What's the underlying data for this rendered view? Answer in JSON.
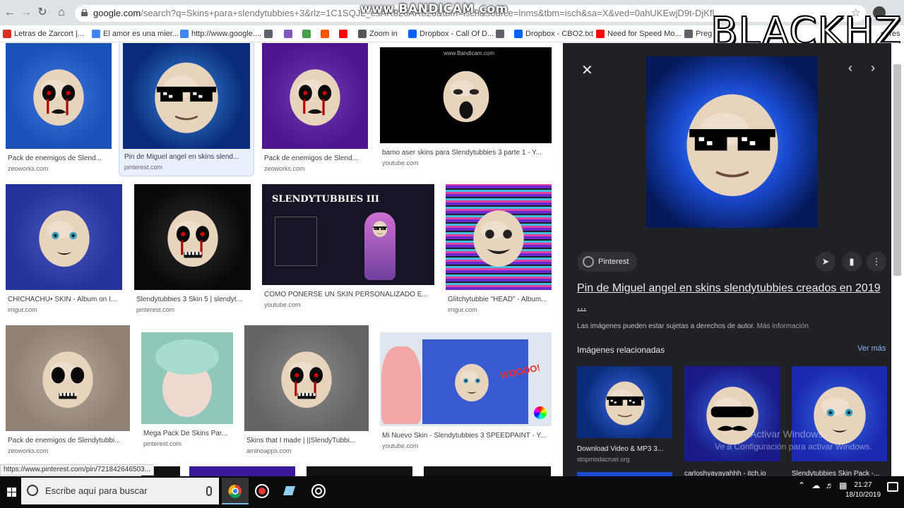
{
  "browser": {
    "url_main": "google.com",
    "url_rest": "/search?q=Skins+para+slendytubbies+3&rlz=1C1SQJL_esAR826AR826&tbm=isch&source=lnms&tbm=isch&sa=X&ved=0ahUKEwjD9t-DjKfl",
    "recorder_watermark": "www.BANDICAM.com"
  },
  "channel_watermark": "BLACKHZ",
  "bookmarks": [
    {
      "label": "Letras de Zarcort |...",
      "icon": "bookmark-zarcort-icon",
      "color": "#d93025"
    },
    {
      "label": "El amor es una mier...",
      "icon": "google-icon",
      "color": "#4285f4"
    },
    {
      "label": "http://www.google....",
      "icon": "google-icon",
      "color": "#4285f4"
    },
    {
      "label": "",
      "icon": "globe-icon",
      "color": "#5f6368"
    },
    {
      "label": "",
      "icon": "tor-icon",
      "color": "#7e57c2"
    },
    {
      "label": "",
      "icon": "gamepad-icon",
      "color": "#43a047"
    },
    {
      "label": "",
      "icon": "soundcloud-icon",
      "color": "#ff5500"
    },
    {
      "label": "",
      "icon": "youtube-icon",
      "color": "#ff0000"
    },
    {
      "label": "Zoom in",
      "icon": "zoom-icon",
      "color": "#555555"
    },
    {
      "label": "Dropbox - Call Of D...",
      "icon": "dropbox-icon",
      "color": "#0061ff"
    },
    {
      "label": "",
      "icon": "globe-icon",
      "color": "#5f6368"
    },
    {
      "label": "Dropbox - CBO2.txt",
      "icon": "dropbox-icon",
      "color": "#0061ff"
    },
    {
      "label": "Need for Speed Mo...",
      "icon": "youtube-icon",
      "color": "#ff0000"
    },
    {
      "label": "Preg",
      "icon": "globe-icon",
      "color": "#5f6368"
    },
    {
      "label": "dores",
      "icon": "",
      "color": "#5f6368"
    }
  ],
  "results": [
    {
      "caption": "Pack de enemigos de Slend...",
      "source": "zeoworks.com",
      "bg": "#1e5fd6"
    },
    {
      "caption": "Pin de Miguel angel en skins slend...",
      "source": "pinterest.com",
      "bg": "#0a2a7a"
    },
    {
      "caption": "Pack de enemigos de Slend...",
      "source": "zeoworks.com",
      "bg": "#5a1aa8"
    },
    {
      "caption": "bamo aser skins para Slendytubbies 3 parte 1 - Y...",
      "source": "youtube.com",
      "bg": "#000000"
    },
    {
      "caption": "CHICHACHU• SKIN - Album on I...",
      "source": "imgur.com",
      "bg": "#2a3ab4"
    },
    {
      "caption": "Slendytubbies 3 Skin 5 | slendyt...",
      "source": "pinterest.com",
      "bg": "#0a0a0a"
    },
    {
      "caption": "COMO PONERSE UN SKIN PERSONALIZADO E...",
      "source": "youtube.com",
      "bg": "#151525"
    },
    {
      "caption": "Glitchytubbie \"HEAD\" - Album...",
      "source": "imgur.com",
      "bg": "#9b3cc8"
    },
    {
      "caption": "Pack de enemigos de Slendytubbi...",
      "source": "zeoworks.com",
      "bg": "#a89888"
    },
    {
      "caption": "Mega Pack De Skins Par...",
      "source": "pinterest.com",
      "bg": "#8fc7b8"
    },
    {
      "caption": "Skins that I made | ||SlendyTubbi...",
      "source": "aminoapps.com",
      "bg": "#777777"
    },
    {
      "caption": "Mi Nuevo Skin - Slendytubbies 3 SPEEDPAINT - Y...",
      "source": "youtube.com",
      "bg": "#3a5ad0"
    }
  ],
  "thumb_texts": {
    "bandicam_small": "www.Bandicam.com",
    "slendy_logo": "SLENDYTUBBIES III",
    "speedpaint_badge": "WOOOO!"
  },
  "status_url": "https://www.pinterest.com/pin/721842646503...",
  "panel": {
    "chip_label": "Pinterest",
    "title": "Pin de Miguel angel en skins slendytubbies creados en 2019 ...",
    "rights_text": "Las imágenes pueden estar sujetas a derechos de autor.",
    "rights_more": "Más información",
    "related_heading": "Imágenes relacionadas",
    "see_more": "Ver más",
    "related": [
      {
        "caption": "Download Video & MP3 3...",
        "source": "stopmodacruel.org",
        "bg": "#0a2a7a"
      },
      {
        "caption": "carloshyayayahhh - itch.io",
        "source": "",
        "bg": "#1a1a8a"
      },
      {
        "caption": "Slendytubbies Skin Pack -...",
        "source": "",
        "bg": "#1a2ab0"
      }
    ],
    "activate_title": "Activar Windows",
    "activate_sub": "Ve a Configuración para activar Windows."
  },
  "taskbar": {
    "search_placeholder": "Escribe aquí para buscar",
    "time": "21:27",
    "date": "18/10/2019"
  }
}
